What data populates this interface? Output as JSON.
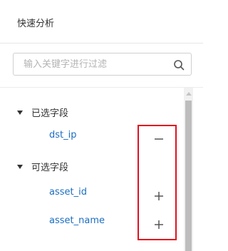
{
  "panel": {
    "title": "快速分析"
  },
  "search": {
    "placeholder": "输入关键字进行过滤",
    "icon": "search-icon"
  },
  "groups": [
    {
      "label": "已选字段",
      "expanded": true,
      "fields": [
        {
          "name": "dst_ip",
          "action": "remove",
          "action_icon": "minus-icon"
        }
      ]
    },
    {
      "label": "可选字段",
      "expanded": true,
      "fields": [
        {
          "name": "asset_id",
          "action": "add",
          "action_icon": "plus-icon"
        },
        {
          "name": "asset_name",
          "action": "add",
          "action_icon": "plus-icon"
        }
      ]
    }
  ],
  "colors": {
    "field_text": "#1b6ec2",
    "highlight": "#e0111f"
  }
}
